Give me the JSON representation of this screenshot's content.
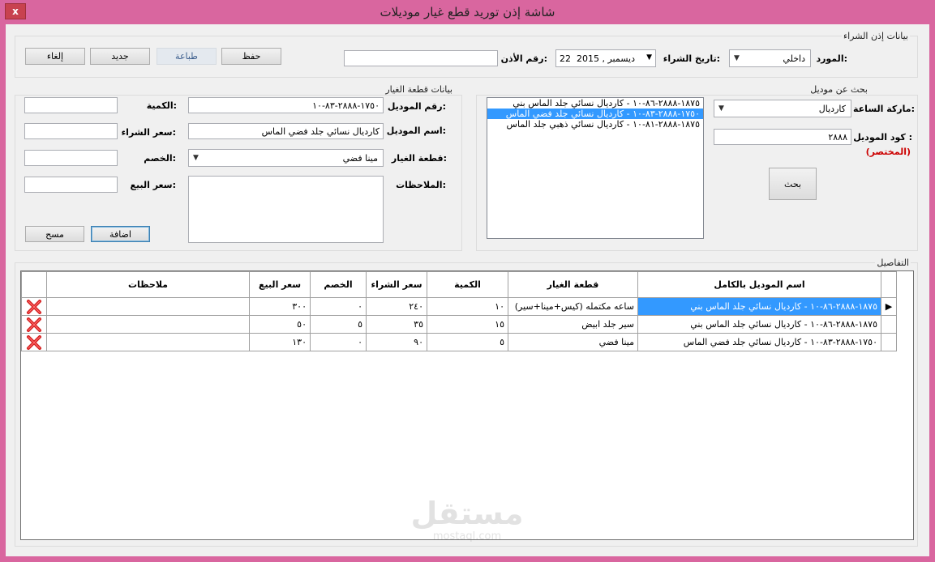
{
  "window": {
    "title": "شاشة إذن توريد قطع غيار موديلات",
    "close_label": "x"
  },
  "purchase": {
    "group_title": "بيانات إذن الشراء",
    "supplier_label": "المورد:",
    "supplier_value": "داخلي",
    "date_label": "تاريخ الشراء:",
    "date_value": "22  ديسمبر , 2015",
    "permit_no_label": "رقم الأذن:",
    "permit_no_value": ""
  },
  "buttons": {
    "save": "حفظ",
    "print": "طباعة",
    "new": "جديد",
    "cancel": "إلغاء"
  },
  "search": {
    "group_title": "بحث عن موديل",
    "brand_label": "ماركة الساعة:",
    "brand_value": "كارديال",
    "code_label": "كود الموديل :",
    "code_value": "٢٨٨٨",
    "short_note": "(المختصر)",
    "search_button": "بحث",
    "results": [
      {
        "text": "١٨٧٥-٢٨٨٨-٨٦-١٠ - كارديال نسائي جلد الماس بني",
        "selected": false
      },
      {
        "text": "١٧٥٠-٢٨٨٨-٨٣-١٠ - كارديال نسائي جلد فضي الماس",
        "selected": true
      },
      {
        "text": "١٨٧٥-٢٨٨٨-٨١-١٠ - كارديال نسائي ذهبي جلد الماس",
        "selected": false
      }
    ]
  },
  "part": {
    "group_title": "بيانات قطعة الغيار",
    "model_no_label": "رقم الموديل:",
    "model_no_value": "١٧٥٠-٢٨٨٨-٨٣-١٠",
    "model_name_label": "اسم الموديل:",
    "model_name_value": "كارديال نسائي جلد فضي الماس",
    "spare_part_label": "قطعة الغيار:",
    "spare_part_value": "مينا فضي",
    "notes_label": "الملاحظات:",
    "notes_value": "",
    "qty_label": "الكمية:",
    "qty_value": "",
    "buy_price_label": "سعر الشراء:",
    "buy_price_value": "",
    "discount_label": "الخصم:",
    "discount_value": "",
    "sell_price_label": "سعر البيع:",
    "sell_price_value": "",
    "add_button": "اضافة",
    "clear_button": "مسح"
  },
  "details": {
    "group_title": "التفاصيل",
    "columns": {
      "full_name": "اسم الموديل بالكامل",
      "spare_part": "قطعة الغيار",
      "qty": "الكمية",
      "buy_price": "سعر الشراء",
      "discount": "الخصم",
      "sell_price": "سعر البيع",
      "notes": "ملاحظات"
    },
    "rows": [
      {
        "full_name": "١٨٧٥-٢٨٨٨-٨٦-١٠ - كارديال نسائي جلد الماس بني",
        "spare_part": "ساعه مكتمله (كيس+مينا+سير)",
        "qty": "١٠",
        "buy_price": "٢٤٠",
        "discount": "٠",
        "sell_price": "٣٠٠",
        "notes": "",
        "current": true
      },
      {
        "full_name": "١٨٧٥-٢٨٨٨-٨٦-١٠ - كارديال نسائي جلد الماس بني",
        "spare_part": "سير جلد ابيض",
        "qty": "١٥",
        "buy_price": "٣٥",
        "discount": "٥",
        "sell_price": "٥٠",
        "notes": "",
        "current": false
      },
      {
        "full_name": "١٧٥٠-٢٨٨٨-٨٣-١٠ - كارديال نسائي جلد فضي الماس",
        "spare_part": "مينا فضي",
        "qty": "٥",
        "buy_price": "٩٠",
        "discount": "٠",
        "sell_price": "١٣٠",
        "notes": "",
        "current": false
      }
    ]
  },
  "colors": {
    "frame": "#d9669f",
    "client": "#f0f0f0",
    "selection": "#3399ff",
    "warning_text": "#cc0000"
  }
}
